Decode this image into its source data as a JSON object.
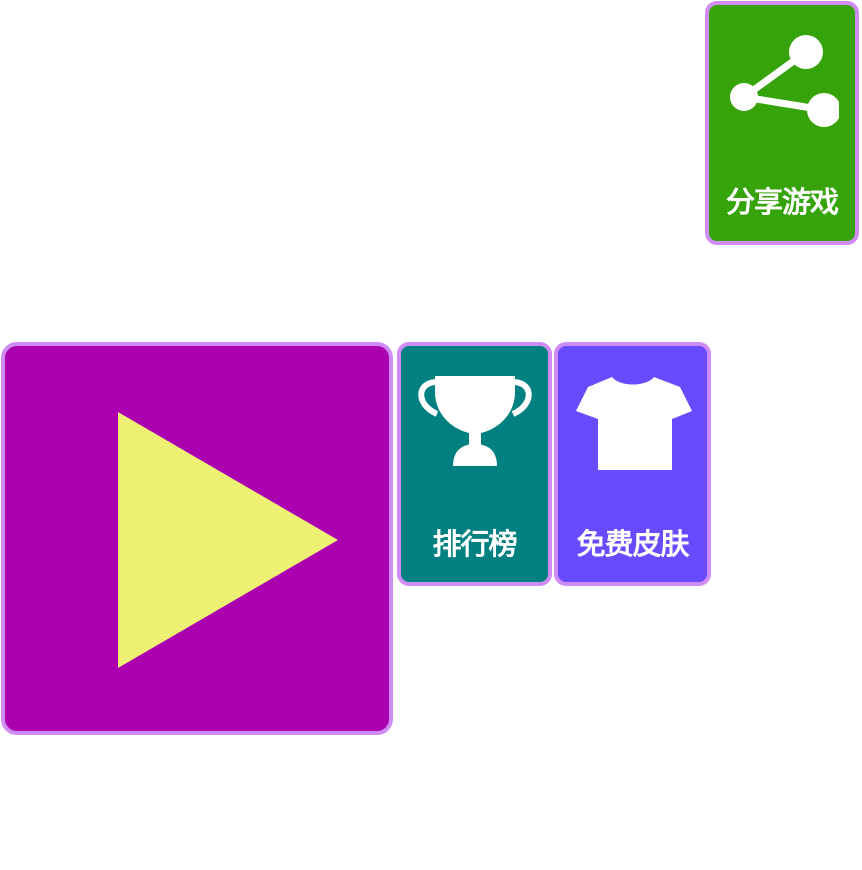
{
  "menu": {
    "share": {
      "label": "分享游戏",
      "icon": "share-icon",
      "color": "#36a30a"
    },
    "play": {
      "icon": "play-icon",
      "color": "#aa00b0",
      "icon_color": "#eef073"
    },
    "leaderboard": {
      "label": "排行榜",
      "icon": "trophy-icon",
      "color": "#008080"
    },
    "skins": {
      "label": "免费皮肤",
      "icon": "tshirt-icon",
      "color": "#664bff"
    },
    "border_color": "#d08cf5"
  }
}
